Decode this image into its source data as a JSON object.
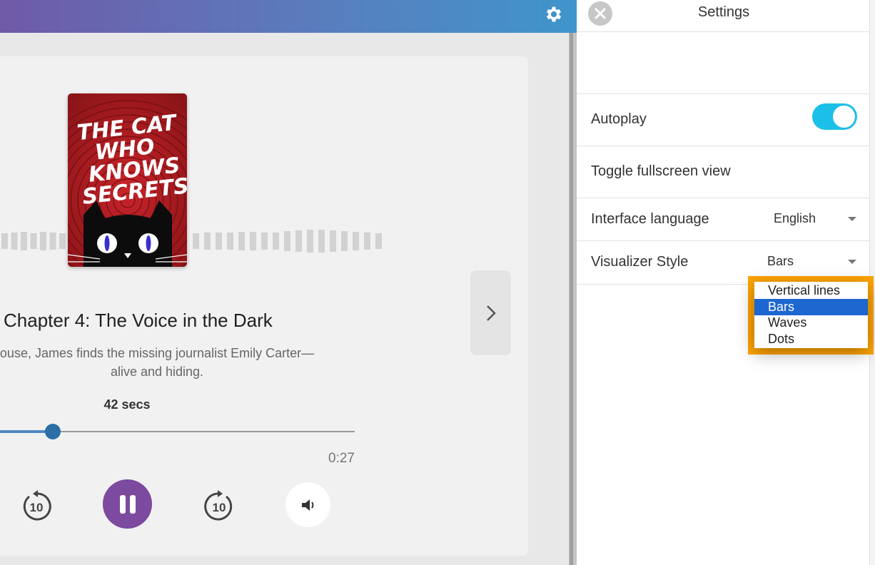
{
  "settings": {
    "title": "Settings",
    "autoplay_label": "Autoplay",
    "autoplay_on": true,
    "fullscreen_label": "Toggle fullscreen view",
    "language_label": "Interface language",
    "language_value": "English",
    "visualizer_label": "Visualizer Style",
    "visualizer_value": "Bars",
    "visualizer_options": [
      "Vertical lines",
      "Bars",
      "Waves",
      "Dots"
    ]
  },
  "player": {
    "cover_title_lines": [
      "THE CAT",
      "WHO",
      "KNOWS",
      "SECRETS"
    ],
    "chapter_title": "Chapter 4: The Voice in the Dark",
    "description_line1": "ouse, James finds the missing journalist Emily Carter—",
    "description_line2": "alive and hiding.",
    "remaining_label": "42 secs",
    "time_code": "0:27",
    "progress_fraction": 0.149,
    "rewind_label": "10",
    "forward_label": "10"
  },
  "colors": {
    "accent_play": "#7c4a9e",
    "toggle_on": "#1cbfe8",
    "option_selected": "#1e66d0",
    "focus_ring": "#ffa500"
  }
}
